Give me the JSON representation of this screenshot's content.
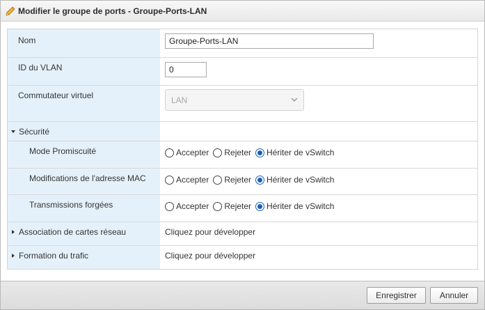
{
  "dialog": {
    "title": "Modifier le groupe de ports - Groupe-Ports-LAN"
  },
  "form": {
    "name_label": "Nom",
    "name_value": "Groupe-Ports-LAN",
    "vlan_label": "ID du VLAN",
    "vlan_value": "0",
    "vswitch_label": "Commutateur virtuel",
    "vswitch_value": "LAN"
  },
  "security": {
    "label": "Sécurité",
    "expanded": true,
    "settings": [
      {
        "label": "Mode Promiscuité",
        "options": [
          "Accepter",
          "Rejeter",
          "Hériter de vSwitch"
        ],
        "selected": "Hériter de vSwitch"
      },
      {
        "label": "Modifications de l'adresse MAC",
        "options": [
          "Accepter",
          "Rejeter",
          "Hériter de vSwitch"
        ],
        "selected": "Hériter de vSwitch"
      },
      {
        "label": "Transmissions forgées",
        "options": [
          "Accepter",
          "Rejeter",
          "Hériter de vSwitch"
        ],
        "selected": "Hériter de vSwitch"
      }
    ]
  },
  "nic_teaming": {
    "label": "Association de cartes réseau",
    "hint": "Cliquez pour développer"
  },
  "traffic_shaping": {
    "label": "Formation du trafic",
    "hint": "Cliquez pour développer"
  },
  "footer": {
    "save_label": "Enregistrer",
    "cancel_label": "Annuler"
  }
}
